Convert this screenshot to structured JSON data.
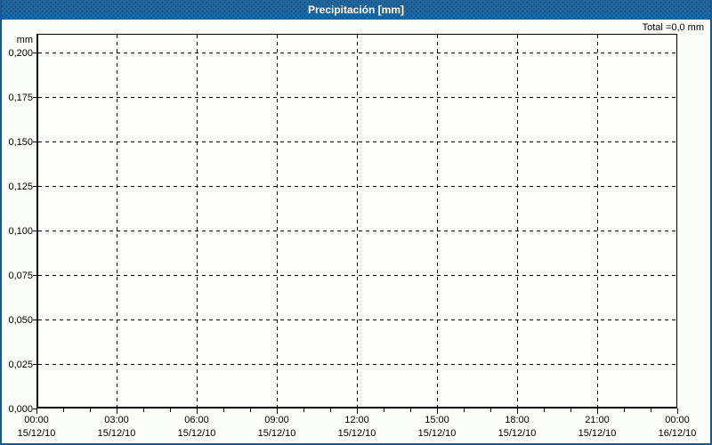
{
  "window": {
    "title": "Precipitación [mm]",
    "total_label": "Total =0,0 mm"
  },
  "colors": {
    "titlebar_bg": "#20689e",
    "titlebar_text": "#ffffff",
    "panel_border": "#1a5a90",
    "panel_bg": "#fbfdf8",
    "plot_border": "#000000",
    "gridline": "#000000",
    "label_text": "#000000"
  },
  "chart_data": {
    "type": "bar",
    "title": "Precipitación [mm]",
    "ylabel_unit": "mm",
    "ylim": [
      0,
      0.2105
    ],
    "xlim_hours": [
      0,
      24
    ],
    "grid": true,
    "minor_tick_every_hours": 1,
    "major_tick_every_hours": 3,
    "y_ticks": [
      {
        "label": "0,200",
        "value": 0.2
      },
      {
        "label": "0,175",
        "value": 0.175
      },
      {
        "label": "0,150",
        "value": 0.15
      },
      {
        "label": "0,125",
        "value": 0.125
      },
      {
        "label": "0,100",
        "value": 0.1
      },
      {
        "label": "0,075",
        "value": 0.075
      },
      {
        "label": "0,050",
        "value": 0.05
      },
      {
        "label": "0,025",
        "value": 0.025
      },
      {
        "label": "0,000",
        "value": 0.0
      }
    ],
    "x_ticks": [
      {
        "time": "00:00",
        "date": "15/12/10",
        "hour": 0
      },
      {
        "time": "03:00",
        "date": "15/12/10",
        "hour": 3
      },
      {
        "time": "06:00",
        "date": "15/12/10",
        "hour": 6
      },
      {
        "time": "09:00",
        "date": "15/12/10",
        "hour": 9
      },
      {
        "time": "12:00",
        "date": "15/12/10",
        "hour": 12
      },
      {
        "time": "15:00",
        "date": "15/12/10",
        "hour": 15
      },
      {
        "time": "18:00",
        "date": "15/12/10",
        "hour": 18
      },
      {
        "time": "21:00",
        "date": "15/12/10",
        "hour": 21
      },
      {
        "time": "00:00",
        "date": "16/12/10",
        "hour": 24
      }
    ],
    "series": [
      {
        "name": "Precipitación",
        "values": [],
        "total": 0.0
      }
    ],
    "total_text": "Total =0,0 mm"
  }
}
